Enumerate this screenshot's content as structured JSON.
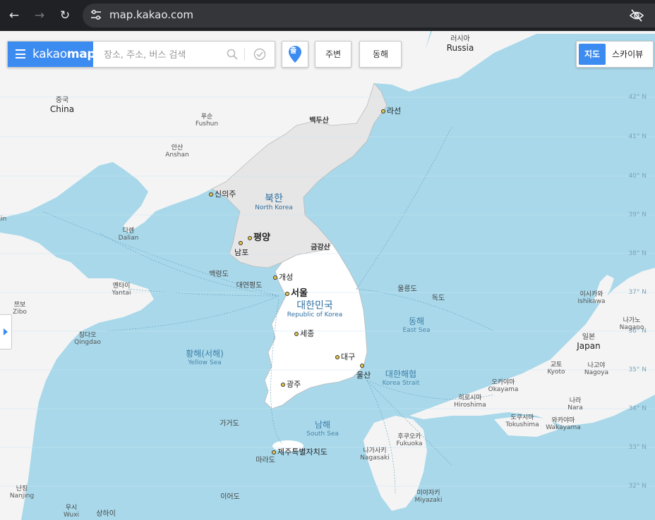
{
  "browser": {
    "url": "map.kakao.com"
  },
  "toolbar": {
    "logo_prefix": "kakao",
    "logo_suffix": "map",
    "search_placeholder": "장소, 주소, 버스 검색",
    "route_button": "출",
    "nearby_button": "주변",
    "region_button": "동해",
    "maptype_map": "지도",
    "maptype_skyview": "스카이뷰"
  },
  "labels": {
    "russia_ko": "러시아",
    "russia_en": "Russia",
    "china_ko": "중국",
    "china_en": "China",
    "fushun_ko": "푸순",
    "fushun_en": "Fushun",
    "anshan_ko": "안산",
    "anshan_en": "Anshan",
    "dalian_ko": "다롄",
    "dalian_en": "Dalian",
    "yantai_ko": "옌타이",
    "yantai_en": "Yantai",
    "zibo_ko": "쯔보",
    "zibo_en": "Zibo",
    "qingdao_ko": "칭다오",
    "qingdao_en": "Qingdao",
    "nanjing_ko": "난징",
    "nanjing_en": "Nanjing",
    "wuxi_ko": "우시",
    "wuxi_en": "Wuxi",
    "shanghai_ko": "상하이",
    "jin": "jin",
    "nk_ko": "북한",
    "nk_en": "North Korea",
    "sk_ko": "대한민국",
    "sk_en": "Republic of Korea",
    "yellow_ko": "황해(서해)",
    "yellow_en": "Yellow Sea",
    "east_ko": "동해",
    "east_en": "East Sea",
    "strait_ko": "대한해협",
    "strait_en": "Korea Strait",
    "south_ko": "남해",
    "south_en": "South Sea",
    "japan_ko": "일본",
    "japan_en": "Japan",
    "ishikawa_ko": "이시카와",
    "ishikawa_en": "Ishikawa",
    "nagano_ko": "나가노",
    "nagano_en": "Nagano",
    "kyoto_ko": "교토",
    "kyoto_en": "Kyoto",
    "nagoya_ko": "나고야",
    "nagoya_en": "Nagoya",
    "okayama_ko": "오카야마",
    "okayama_en": "Okayama",
    "hiroshima_ko": "히로시마",
    "hiroshima_en": "Hiroshima",
    "nara_ko": "나라",
    "nara_en": "Nara",
    "tokushima_ko": "도쿠시마",
    "tokushima_en": "Tokushima",
    "wakayama_ko": "와카야마",
    "wakayama_en": "Wakayama",
    "fukuoka_ko": "후쿠오카",
    "fukuoka_en": "Fukuoka",
    "nagasaki_ko": "나가사키",
    "nagasaki_en": "Nagasaki",
    "miyazaki_ko": "미야자키",
    "miyazaki_en": "Miyazaki",
    "baekdu": "백두산",
    "geumgang": "금강산",
    "ulleungdo": "울릉도",
    "dokdo": "독도",
    "baengnyeongdo": "백령도",
    "yeonpyeong": "대연평도",
    "gageodo": "가거도",
    "marado": "마라도",
    "ieodo": "이어도"
  },
  "cities": {
    "rason": "라선",
    "sinuiju": "신의주",
    "pyongyang": "평양",
    "nampo": "남포",
    "kaesong": "개성",
    "seoul": "서울",
    "sejong": "세종",
    "daegu": "대구",
    "ulsan": "울산",
    "gwangju": "광주",
    "jeju": "제주특별자치도"
  },
  "latitudes": [
    "42° N",
    "41° N",
    "40° N",
    "39° N",
    "38° N",
    "37° N",
    "36° N",
    "35° N",
    "34° N",
    "33° N",
    "32° N"
  ],
  "colors": {
    "sea": "#a8d8ea",
    "land_foreign": "#f4f4f4",
    "north_korea": "#e6e6e6",
    "south_korea": "#ffffff",
    "accent": "#3b8bf0"
  }
}
